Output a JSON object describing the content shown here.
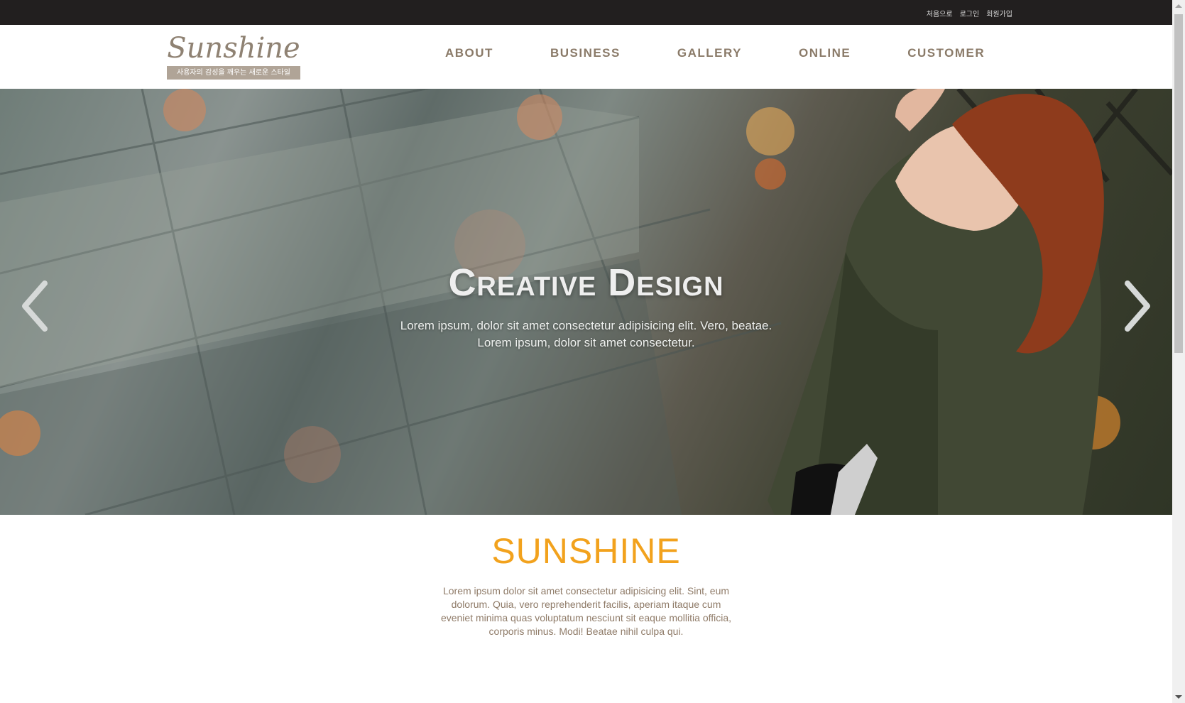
{
  "topbar": {
    "links": [
      "처음으로",
      "로그인",
      "회원가입"
    ]
  },
  "logo": {
    "script": "Sunshine",
    "tagline": "사용자의 감성을 깨우는 새로운 스타일"
  },
  "nav": {
    "items": [
      "ABOUT",
      "BUSINESS",
      "GALLERY",
      "ONLINE",
      "CUSTOMER"
    ]
  },
  "hero": {
    "title": "Creative Design",
    "subtitle_line1": "Lorem ipsum, dolor sit amet consectetur adipisicing elit. Vero, beatae.",
    "subtitle_line2": "Lorem ipsum, dolor sit amet consectetur.",
    "prev_icon": "chevron-left-icon",
    "next_icon": "chevron-right-icon"
  },
  "intro": {
    "heading": "SUNSHINE",
    "body": "Lorem ipsum dolor sit amet consectetur adipisicing elit. Sint, eum dolorum. Quia, vero reprehenderit facilis, aperiam itaque cum eveniet minima quas voluptatum nesciunt sit eaque mollitia officia, corporis minus. Modi! Beatae nihil culpa qui."
  },
  "colors": {
    "topbar": "#221f1f",
    "nav_text": "#8a7a68",
    "accent": "#f2a21d",
    "body_text": "#8f7b68"
  }
}
